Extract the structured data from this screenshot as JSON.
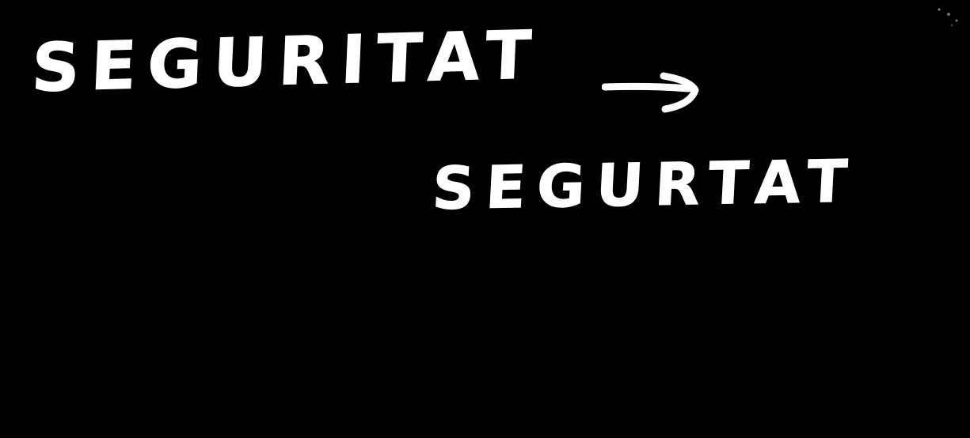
{
  "board": {
    "background_color": "#000000",
    "ink_color": "#ffffff",
    "word_before": "SEGURITAT",
    "word_after": "SEGURTAT",
    "arrow_icon": "right-arrow-icon"
  }
}
